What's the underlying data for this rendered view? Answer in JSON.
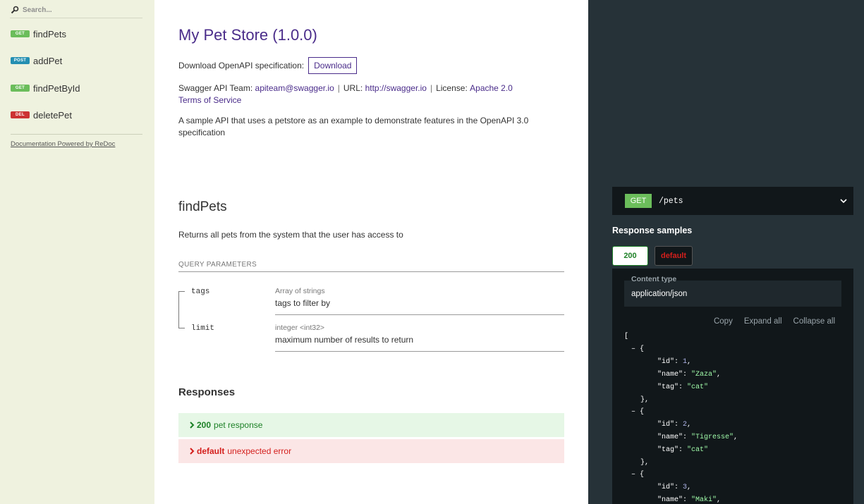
{
  "sidebar": {
    "search_placeholder": "Search...",
    "items": [
      {
        "method": "GET",
        "label": "findPets"
      },
      {
        "method": "POST",
        "label": "addPet"
      },
      {
        "method": "GET",
        "label": "findPetById"
      },
      {
        "method": "DEL",
        "label": "deletePet"
      }
    ],
    "powered_by": "Documentation Powered by ReDoc"
  },
  "api": {
    "title": "My Pet Store (1.0.0)",
    "download_label": "Download OpenAPI specification:",
    "download_button": "Download",
    "contact_prefix": "Swagger API Team:",
    "contact_email": "apiteam@swagger.io",
    "url_prefix": "URL:",
    "url": "http://swagger.io",
    "license_prefix": "License:",
    "license": "Apache 2.0",
    "terms": "Terms of Service",
    "description": "A sample API that uses a petstore as an example to demonstrate features in the OpenAPI 3.0 specification"
  },
  "operation": {
    "title": "findPets",
    "description": "Returns all pets from the system that the user has access to",
    "query_params_heading": "QUERY PARAMETERS",
    "params": [
      {
        "name": "tags",
        "type_prefix": "Array of",
        "type": "strings",
        "description": "tags to filter by"
      },
      {
        "name": "limit",
        "type_prefix": "",
        "type": "integer <int32>",
        "description": "maximum number of results to return"
      }
    ],
    "responses_heading": "Responses",
    "responses": [
      {
        "code": "200",
        "text": "pet response"
      },
      {
        "code": "default",
        "text": "unexpected error"
      }
    ]
  },
  "right_panel": {
    "method": "GET",
    "path": "/pets",
    "samples_heading": "Response samples",
    "tabs": [
      "200",
      "default"
    ],
    "content_type_label": "Content type",
    "content_type": "application/json",
    "actions": [
      "Copy",
      "Expand all",
      "Collapse all"
    ],
    "pets": [
      {
        "id": "1",
        "name": "\"Zaza\"",
        "tag": "\"cat\""
      },
      {
        "id": "2",
        "name": "\"Tigresse\"",
        "tag": "\"cat\""
      },
      {
        "id": "3",
        "name": "\"Maki\""
      }
    ]
  },
  "colors": {
    "get": "#6bbd5b",
    "post": "#248fb2",
    "delete": "#cc3333",
    "accent": "#4a2c8a"
  }
}
